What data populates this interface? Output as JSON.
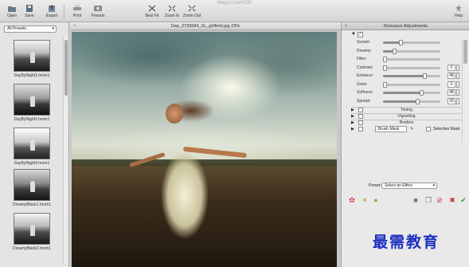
{
  "app": {
    "title": "MagicColorHDR"
  },
  "toolbar": {
    "open": "Open",
    "save": "Save",
    "export": "Export",
    "print": "Print",
    "presets": "Presets",
    "best_fit": "Best Fit",
    "zoom_in": "Zoom In",
    "zoom_out": "Zoom Out",
    "help": "Help"
  },
  "left_panel": {
    "filter": "All Presets",
    "items": [
      {
        "label": "DayByNight1.hrom1"
      },
      {
        "label": "DayByNight2.hrom1"
      },
      {
        "label": "DayByNight3.hrom1"
      },
      {
        "label": "DreamyBlack1.hrom1"
      },
      {
        "label": "DreamyBlack2.hrom1"
      }
    ]
  },
  "document": {
    "title": "Dep_3730584_XL_girlfield.jpg 23%"
  },
  "right_panel": {
    "title": "Romance Adjustments",
    "adjustments": [
      {
        "label": "Sunset:",
        "value": "",
        "level": 0.3,
        "has_value": false
      },
      {
        "label": "Dreamy:",
        "value": "",
        "level": 0.2,
        "has_value": false
      },
      {
        "label": "Filter:",
        "value": "",
        "level": 0.0,
        "has_value": false
      },
      {
        "label": "Contrast:",
        "value": "0",
        "level": 0.0,
        "has_value": true
      },
      {
        "label": "Enhance:",
        "value": "48",
        "level": 0.72,
        "has_value": true
      },
      {
        "label": "Grain:",
        "value": "0",
        "level": 0.0,
        "has_value": true
      },
      {
        "label": "Softness:",
        "value": "48",
        "level": 0.66,
        "has_value": true
      },
      {
        "label": "Spread:",
        "value": "30",
        "level": 0.6,
        "has_value": true
      }
    ],
    "sections": {
      "toning": "Toning",
      "vignetting": "Vignetting",
      "borders": "Borders"
    },
    "brush_mask": "Brush Mask",
    "selective_mask": "Selective Mask",
    "preset_label": "Preset:",
    "preset_value": "Select an Effect"
  },
  "watermark": "最需教育"
}
